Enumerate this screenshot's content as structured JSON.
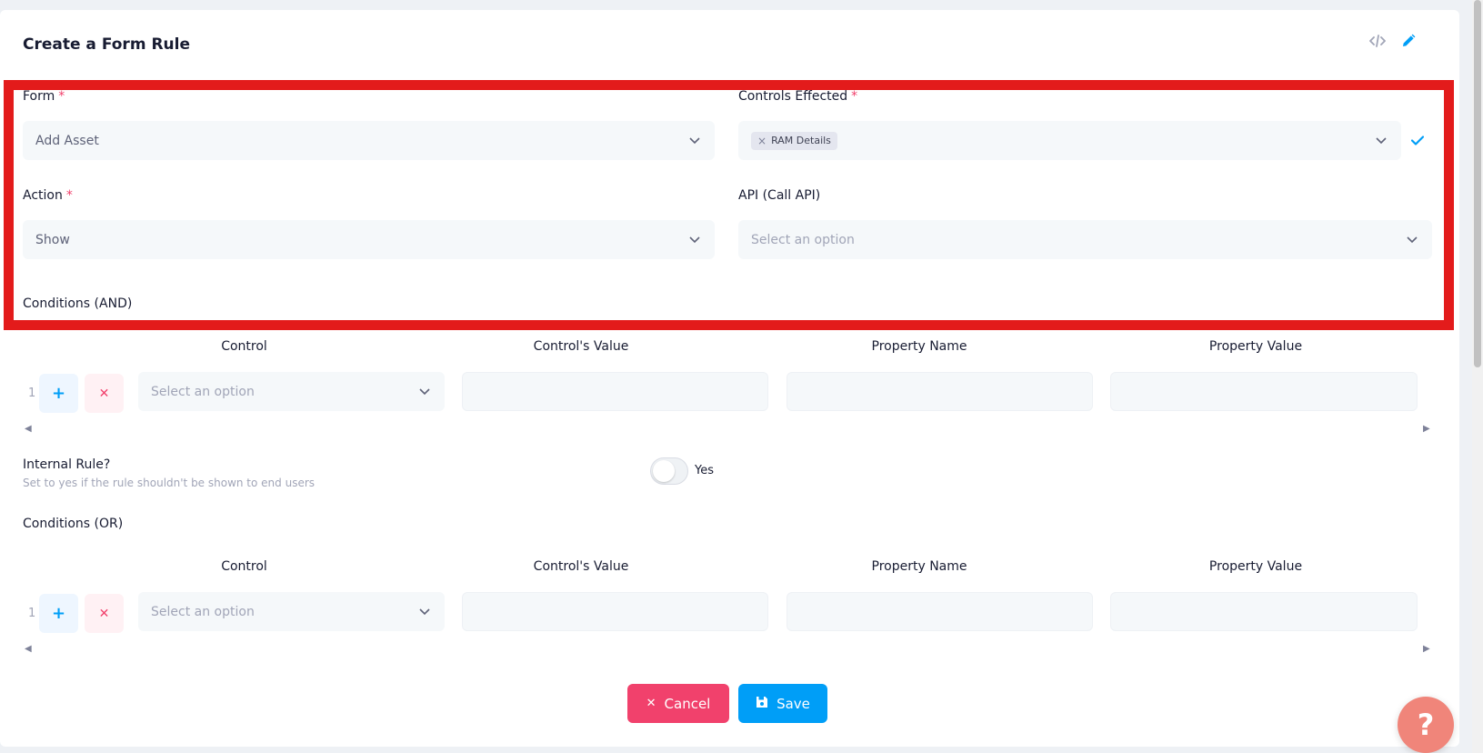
{
  "page": {
    "title": "Create a Form Rule",
    "icons": [
      "code-icon",
      "pencil-icon"
    ]
  },
  "form": {
    "label": "Form",
    "required": "*",
    "value": "Add Asset"
  },
  "controls_effected": {
    "label": "Controls Effected",
    "required": "*",
    "tag": "RAM Details"
  },
  "action": {
    "label": "Action",
    "required": "*",
    "value": "Show"
  },
  "api": {
    "label": "API (Call API)",
    "placeholder": "Select an option"
  },
  "conditions_and": {
    "title": "Conditions (AND)",
    "columns": [
      "Control",
      "Control's Value",
      "Property Name",
      "Property Value"
    ],
    "row_number": "1",
    "control_placeholder": "Select an option"
  },
  "internal_rule": {
    "label": "Internal Rule?",
    "description": "Set to yes if the rule shouldn't be shown to end users",
    "toggle_label": "Yes"
  },
  "conditions_or": {
    "title": "Conditions (OR)",
    "columns": [
      "Control",
      "Control's Value",
      "Property Name",
      "Property Value"
    ],
    "row_number": "1",
    "control_placeholder": "Select an option"
  },
  "buttons": {
    "cancel": "Cancel",
    "save": "Save"
  },
  "help": {
    "label": "?"
  },
  "colors": {
    "primary": "#009ef7",
    "danger": "#f1416c",
    "highlight": "#e31b1b",
    "help": "#f0857a"
  }
}
